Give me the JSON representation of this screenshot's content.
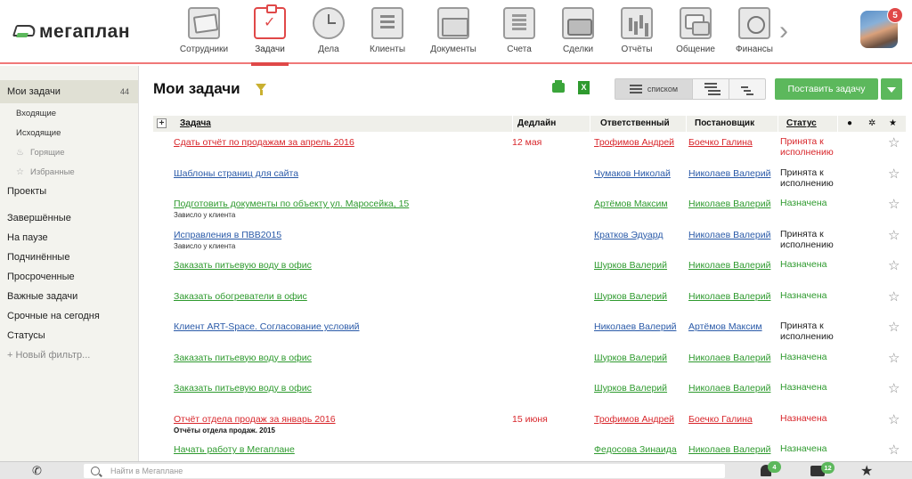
{
  "logo": {
    "text": "мегаплан"
  },
  "nav": {
    "items": [
      {
        "label": "Сотрудники",
        "icon": "employees-icon"
      },
      {
        "label": "Задачи",
        "icon": "tasks-icon",
        "active": true
      },
      {
        "label": "Дела",
        "icon": "clock-icon"
      },
      {
        "label": "Клиенты",
        "icon": "contacts-book-icon"
      },
      {
        "label": "Документы",
        "icon": "folder-icon"
      },
      {
        "label": "Счета",
        "icon": "invoice-icon"
      },
      {
        "label": "Сделки",
        "icon": "briefcase-icon"
      },
      {
        "label": "Отчёты",
        "icon": "chart-icon"
      },
      {
        "label": "Общение",
        "icon": "chat-icon"
      },
      {
        "label": "Финансы",
        "icon": "safe-icon"
      }
    ],
    "avatar_badge": "5",
    "accent": "#e04848"
  },
  "sidebar": {
    "my_tasks": {
      "label": "Мои задачи",
      "count": "44"
    },
    "incoming": "Входящие",
    "outgoing": "Исходящие",
    "burning": "Горящие",
    "favorites": "Избранные",
    "projects": "Проекты",
    "completed": "Завершённые",
    "paused": "На паузе",
    "subordinate": "Подчинённые",
    "overdue": "Просроченные",
    "important": "Важные задачи",
    "urgent_today": "Срочные на сегодня",
    "statuses": "Статусы",
    "new_filter": "+ Новый фильтр..."
  },
  "main": {
    "title": "Мои задачи",
    "view_list_label": "списком",
    "add_task_label": "Поставить задачу",
    "excel_label": "X",
    "accent_green": "#5cb85c"
  },
  "table": {
    "headers": {
      "task": "Задача",
      "deadline": "Дедлайн",
      "responsible": "Ответственный",
      "creator": "Постановщик",
      "status": "Статус"
    },
    "rows": [
      {
        "task": "Сдать отчёт по продажам за апрель 2016",
        "task_color": "red",
        "sub": "",
        "deadline": "12 мая",
        "responsible": "Трофимов Андрей",
        "resp_color": "red",
        "creator": "Боечко Галина",
        "creator_color": "red",
        "status1": "Принята к",
        "status2": "исполнению",
        "status_color": "red"
      },
      {
        "task": "Шаблоны страниц для сайта",
        "task_color": "blue",
        "sub": "",
        "deadline": "",
        "responsible": "Чумаков Николай",
        "resp_color": "blue",
        "creator": "Николаев Валерий",
        "creator_color": "blue",
        "status1": "Принята к",
        "status2": "исполнению",
        "status_color": "dark"
      },
      {
        "task": "Подготовить документы по объекту ул. Маросейка, 15",
        "task_color": "green",
        "sub": "Зависло у клиента",
        "deadline": "",
        "responsible": "Артёмов Максим",
        "resp_color": "green",
        "creator": "Николаев Валерий",
        "creator_color": "green",
        "status1": "Назначена",
        "status2": "",
        "status_color": "green"
      },
      {
        "task": "Исправления в ПВВ2015",
        "task_color": "blue",
        "sub": "Зависло у клиента",
        "deadline": "",
        "responsible": "Кратков Эдуард",
        "resp_color": "blue",
        "creator": "Николаев Валерий",
        "creator_color": "blue",
        "status1": "Принята к",
        "status2": "исполнению",
        "status_color": "dark"
      },
      {
        "task": "Заказать питьевую воду в офис",
        "task_color": "green",
        "sub": "",
        "deadline": "",
        "responsible": "Шурков Валерий",
        "resp_color": "green",
        "creator": "Николаев Валерий",
        "creator_color": "green",
        "status1": "Назначена",
        "status2": "",
        "status_color": "green"
      },
      {
        "task": "Заказать обогреватели в офис",
        "task_color": "green",
        "sub": "",
        "deadline": "",
        "responsible": "Шурков Валерий",
        "resp_color": "green",
        "creator": "Николаев Валерий",
        "creator_color": "green",
        "status1": "Назначена",
        "status2": "",
        "status_color": "green"
      },
      {
        "task": "Клиент ART-Space. Согласование условий",
        "task_color": "blue",
        "sub": "",
        "deadline": "",
        "responsible": "Николаев Валерий",
        "resp_color": "blue",
        "creator": "Артёмов Максим",
        "creator_color": "blue",
        "status1": "Принята к",
        "status2": "исполнению",
        "status_color": "dark"
      },
      {
        "task": "Заказать питьевую воду в офис",
        "task_color": "green",
        "sub": "",
        "deadline": "",
        "responsible": "Шурков Валерий",
        "resp_color": "green",
        "creator": "Николаев Валерий",
        "creator_color": "green",
        "status1": "Назначена",
        "status2": "",
        "status_color": "green"
      },
      {
        "task": "Заказать питьевую воду в офис",
        "task_color": "green",
        "sub": "",
        "deadline": "",
        "responsible": "Шурков Валерий",
        "resp_color": "green",
        "creator": "Николаев Валерий",
        "creator_color": "green",
        "status1": "Назначена",
        "status2": "",
        "status_color": "green"
      },
      {
        "task": "Отчёт отдела продаж за январь 2016",
        "task_color": "red",
        "sub": "Отчёты отдела продаж. 2015",
        "sub_bold": true,
        "deadline": "15 июня",
        "responsible": "Трофимов Андрей",
        "resp_color": "red",
        "creator": "Боечко Галина",
        "creator_color": "red",
        "status1": "Назначена",
        "status2": "",
        "status_color": "red"
      },
      {
        "task": "Начать работу в Мегаплане",
        "task_color": "green",
        "sub": "",
        "deadline": "",
        "responsible": "Федосова Зинаида",
        "resp_color": "green",
        "creator": "Николаев Валерий",
        "creator_color": "green",
        "status1": "Назначена",
        "status2": "",
        "status_color": "green"
      }
    ]
  },
  "bottom": {
    "search_placeholder": "Найти в Мегаплане",
    "notifications_count": "4",
    "messages_count": "12"
  }
}
